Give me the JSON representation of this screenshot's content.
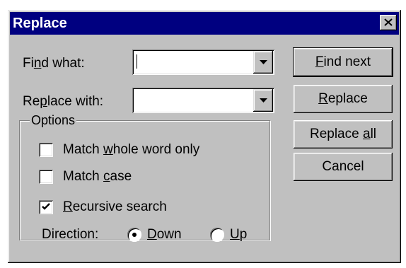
{
  "window": {
    "title": "Replace",
    "close_icon": "close-icon"
  },
  "fields": {
    "find_label": {
      "before": "Fi",
      "accel": "n",
      "after": "d what:"
    },
    "find_value": "",
    "replace_label": {
      "before": "Re",
      "accel": "p",
      "after": "lace with:"
    },
    "replace_value": "",
    "dropdown_icon": "chevron-down-icon"
  },
  "buttons": {
    "find_next": {
      "before": "",
      "accel": "F",
      "after": "ind next"
    },
    "replace": {
      "before": "",
      "accel": "R",
      "after": "eplace"
    },
    "replace_all": {
      "before": "Replace ",
      "accel": "a",
      "after": "ll"
    },
    "cancel": "Cancel"
  },
  "options": {
    "legend": "Options",
    "match_whole_word": {
      "before": "Match ",
      "accel": "w",
      "after": "hole word only",
      "checked": false
    },
    "match_case": {
      "before": "Match ",
      "accel": "c",
      "after": "ase",
      "checked": false
    },
    "recursive": {
      "before": "",
      "accel": "R",
      "after": "ecursive search",
      "checked": true
    },
    "direction_label": "Direction:",
    "down": {
      "before": "",
      "accel": "D",
      "after": "own",
      "selected": true
    },
    "up": {
      "before": "",
      "accel": "U",
      "after": "p",
      "selected": false
    }
  }
}
